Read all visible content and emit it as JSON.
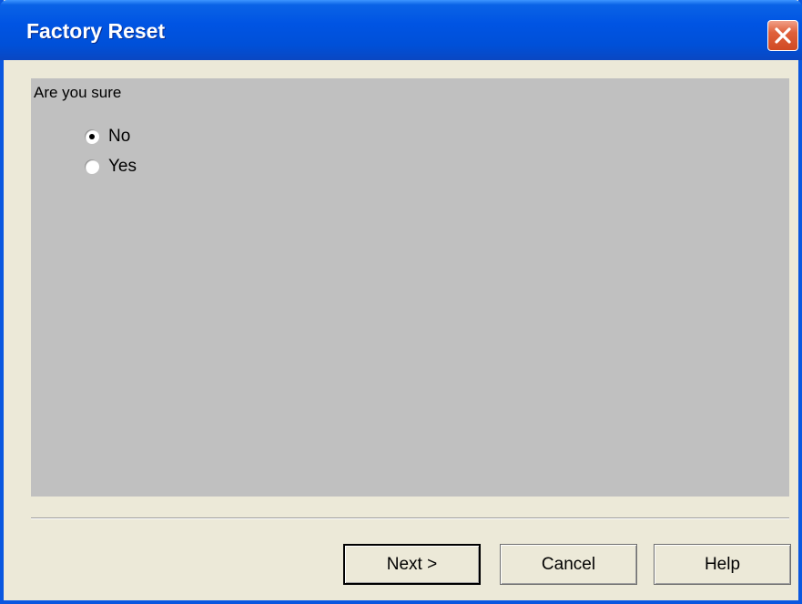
{
  "window": {
    "title": "Factory Reset"
  },
  "dialog": {
    "question": "Are you sure",
    "options": [
      {
        "label": "No",
        "selected": true
      },
      {
        "label": "Yes",
        "selected": false
      }
    ]
  },
  "buttons": {
    "next_label": "Next >",
    "cancel_label": "Cancel",
    "help_label": "Help"
  },
  "icons": {
    "close": "close-icon"
  },
  "colors": {
    "titlebar": "#0054e3",
    "window_bg": "#ece9d8",
    "panel_bg": "#c0c0c0",
    "close_button": "#e0603a"
  }
}
